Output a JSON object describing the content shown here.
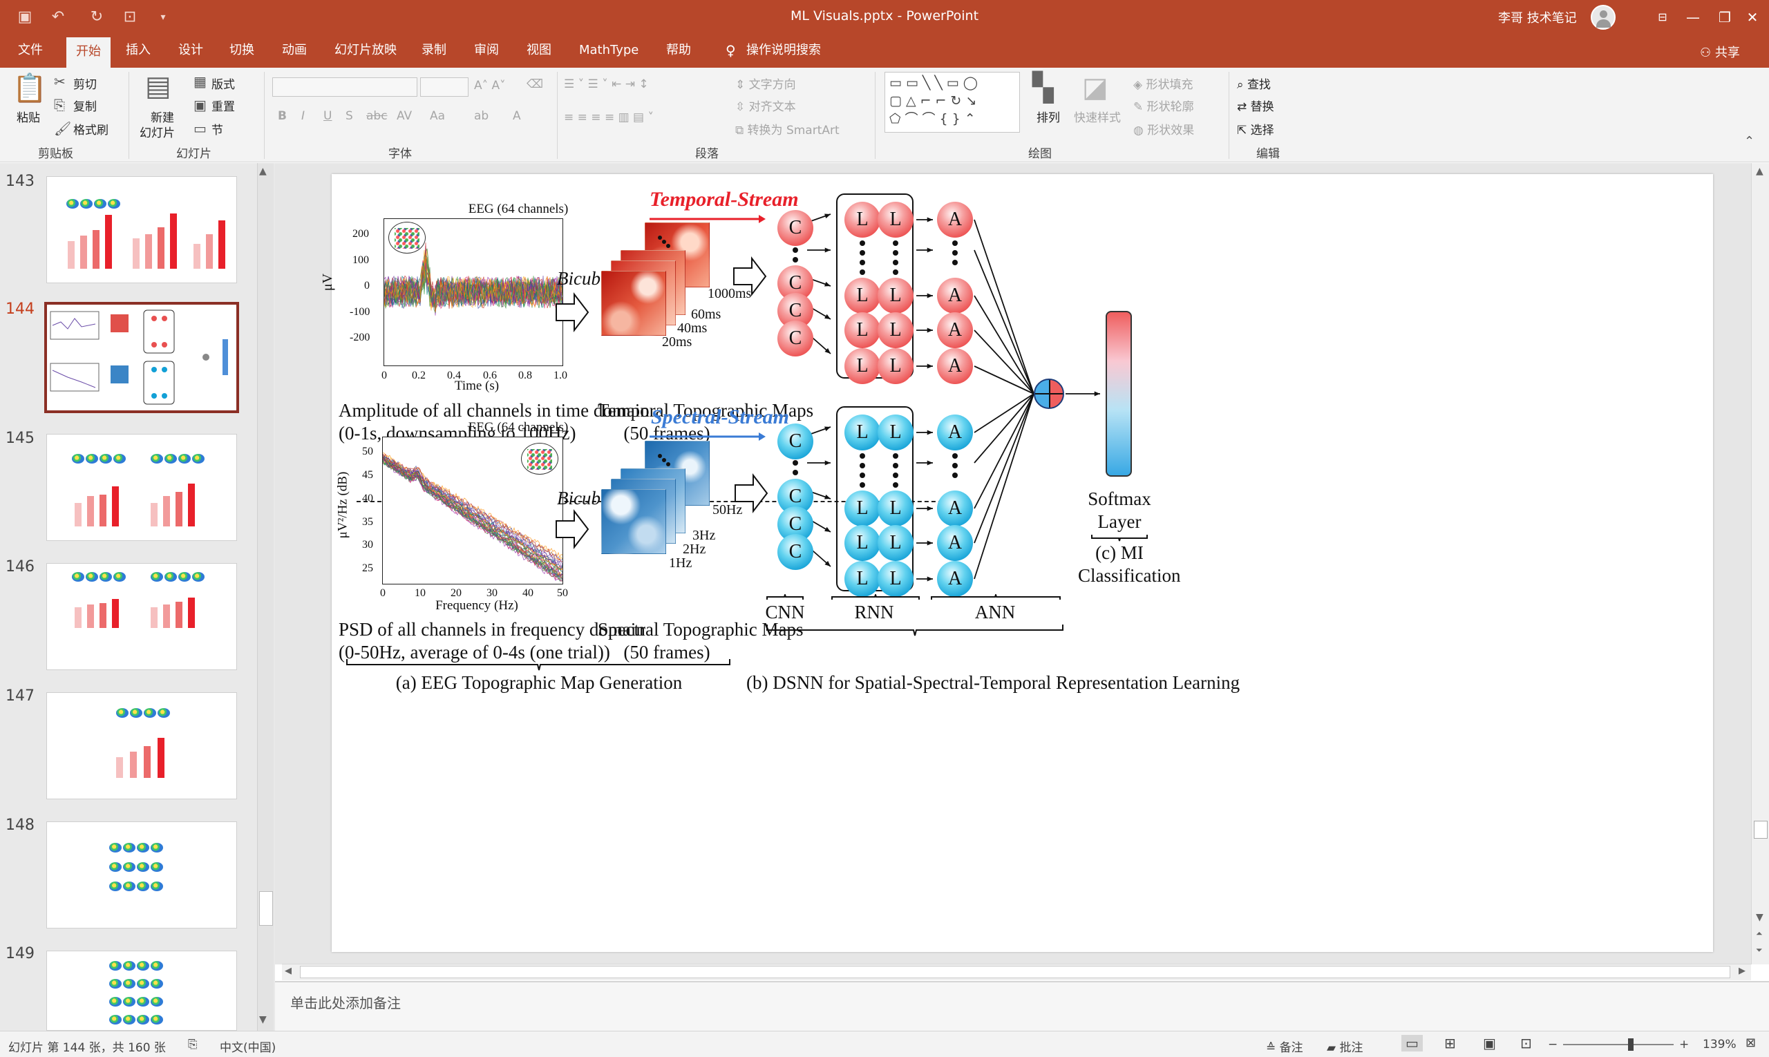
{
  "window": {
    "title": "ML Visuals.pptx  -  PowerPoint",
    "user_name": "李哥 技术笔记",
    "controls": [
      "—",
      "❐",
      "✕"
    ]
  },
  "quick_access": [
    "save-icon",
    "undo-icon",
    "redo-icon",
    "slideshow-icon",
    "customize-icon"
  ],
  "tabs": [
    "文件",
    "开始",
    "插入",
    "设计",
    "切换",
    "动画",
    "幻灯片放映",
    "录制",
    "审阅",
    "视图",
    "MathType",
    "帮助",
    "操作说明搜索"
  ],
  "active_tab": "开始",
  "share_label": "共享",
  "ribbon": {
    "clipboard": {
      "paste": "粘贴",
      "cut": "剪切",
      "copy": "复制",
      "format_painter": "格式刷",
      "group": "剪贴板"
    },
    "slides": {
      "new_slide_1": "新建",
      "new_slide_2": "幻灯片",
      "layout": "版式",
      "reset": "重置",
      "section": "节",
      "group": "幻灯片"
    },
    "font": {
      "group": "字体",
      "case_label": "Aa"
    },
    "paragraph": {
      "text_direction": "文字方向",
      "align_text": "对齐文本",
      "smartart": "转换为 SmartArt",
      "group": "段落"
    },
    "drawing": {
      "arrange": "排列",
      "quick_styles": "快速样式",
      "shape_fill": "形状填充",
      "shape_outline": "形状轮廓",
      "shape_effects": "形状效果",
      "group": "绘图"
    },
    "editing": {
      "find": "查找",
      "replace": "替换",
      "select": "选择",
      "group": "编辑"
    }
  },
  "thumbnails": [
    {
      "number": "143",
      "active": false
    },
    {
      "number": "144",
      "active": true
    },
    {
      "number": "145",
      "active": false
    },
    {
      "number": "146",
      "active": false
    },
    {
      "number": "147",
      "active": false
    },
    {
      "number": "148",
      "active": false
    },
    {
      "number": "149",
      "active": false
    }
  ],
  "slide": {
    "top_plot": {
      "title": "EEG (64 channels)",
      "ylabel": "μV",
      "xlabel": "Time (s)",
      "yticks": [
        "200",
        "100",
        "0",
        "-100",
        "-200"
      ],
      "xticks": [
        "0",
        "0.2",
        "0.4",
        "0.6",
        "0.8",
        "1.0"
      ],
      "caption_1": "Amplitude of all channels in time domain",
      "caption_2": "(0-1s, downsampling to 100Hz)"
    },
    "bottom_plot": {
      "title": "EEG (64 channels)",
      "ylabel": "μV²/Hz (dB)",
      "xlabel": "Frequency (Hz)",
      "yticks": [
        "50",
        "45",
        "40",
        "35",
        "30",
        "25"
      ],
      "xticks": [
        "0",
        "10",
        "20",
        "30",
        "40",
        "50"
      ],
      "caption_1": "PSD of all channels in frequency domain",
      "caption_2": "(0-50Hz, average of 0-4s (one trial))"
    },
    "bicubic_top": "Bicubic",
    "bicubic_bottom": "Bicubic",
    "temporal_stream": "Temporal-Stream",
    "spectral_stream": "Spectral-Stream",
    "temporal_frames": [
      "1000ms",
      "60ms",
      "40ms",
      "20ms"
    ],
    "spectral_frames": [
      "50Hz",
      "3Hz",
      "2Hz",
      "1Hz"
    ],
    "temporal_caption_1": "Temporal Topographic Maps",
    "temporal_caption_2": "(50 frames)",
    "spectral_caption_1": "Spectral Topographic Maps",
    "spectral_caption_2": "(50 frames)",
    "node_c": "C",
    "node_l": "L",
    "node_a": "A",
    "softmax_1": "Softmax",
    "softmax_2": "Layer",
    "mi_1": "(c) MI",
    "mi_2": "Classification",
    "cnn": "CNN",
    "rnn": "RNN",
    "ann": "ANN",
    "section_a": "(a) EEG Topographic Map Generation",
    "section_b": "(b) DSNN for Spatial-Spectral-Temporal Representation Learning",
    "colors": {
      "temporal": "#e8202a",
      "spectral": "#3a7bd5"
    }
  },
  "notes_placeholder": "单击此处添加备注",
  "status": {
    "slide_info": "幻灯片 第 144 张，共 160 张",
    "language": "中文(中国)",
    "notes": "备注",
    "comments": "批注",
    "zoom": "139%"
  }
}
